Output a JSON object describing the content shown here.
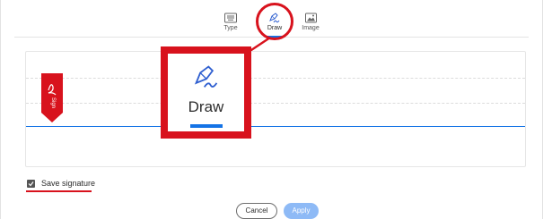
{
  "tabs": [
    {
      "label": "Type",
      "icon": "keyboard-icon"
    },
    {
      "label": "Draw",
      "icon": "pen-icon",
      "selected": true
    },
    {
      "label": "Image",
      "icon": "image-icon"
    }
  ],
  "zoom_callout": {
    "label": "Draw",
    "icon": "pen-icon"
  },
  "flag": {
    "text": "Sign",
    "icon": "acrobat-logo-icon"
  },
  "save_signature": {
    "label": "Save signature",
    "checked": true
  },
  "buttons": {
    "cancel": "Cancel",
    "apply": "Apply"
  },
  "colors": {
    "accent": "#1473e6",
    "highlight_red": "#d8121d",
    "apply_disabled": "#8ebaf6"
  }
}
